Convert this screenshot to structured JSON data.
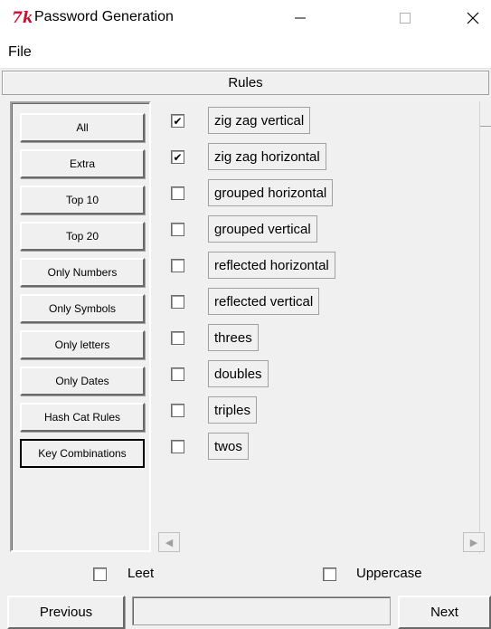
{
  "window": {
    "title": "Password Generation",
    "minimize_glyph": "—",
    "maximize_glyph": "☐",
    "close_glyph": "✕",
    "icon": "tk-feather-icon"
  },
  "menu": {
    "file_label": "File"
  },
  "rules_header": "Rules",
  "rule_buttons": [
    "All",
    "Extra",
    "Top 10",
    "Top 20",
    "Only Numbers",
    "Only Symbols",
    "Only letters",
    "Only Dates",
    "Hash Cat Rules",
    "Key Combinations"
  ],
  "active_rule": "Key Combinations",
  "options": [
    {
      "label": "zig zag vertical",
      "checked": true
    },
    {
      "label": "zig zag horizontal",
      "checked": true
    },
    {
      "label": "grouped horizontal",
      "checked": false
    },
    {
      "label": "grouped vertical",
      "checked": false
    },
    {
      "label": "reflected horizontal",
      "checked": false
    },
    {
      "label": "reflected vertical",
      "checked": false
    },
    {
      "label": "threes",
      "checked": false
    },
    {
      "label": "doubles",
      "checked": false
    },
    {
      "label": "triples",
      "checked": false
    },
    {
      "label": "twos",
      "checked": false
    }
  ],
  "bottom_options": {
    "leet": {
      "label": "Leet",
      "checked": false
    },
    "uppercase": {
      "label": "Uppercase",
      "checked": false
    }
  },
  "nav": {
    "previous": "Previous",
    "next": "Next"
  },
  "check_glyph": "✔"
}
